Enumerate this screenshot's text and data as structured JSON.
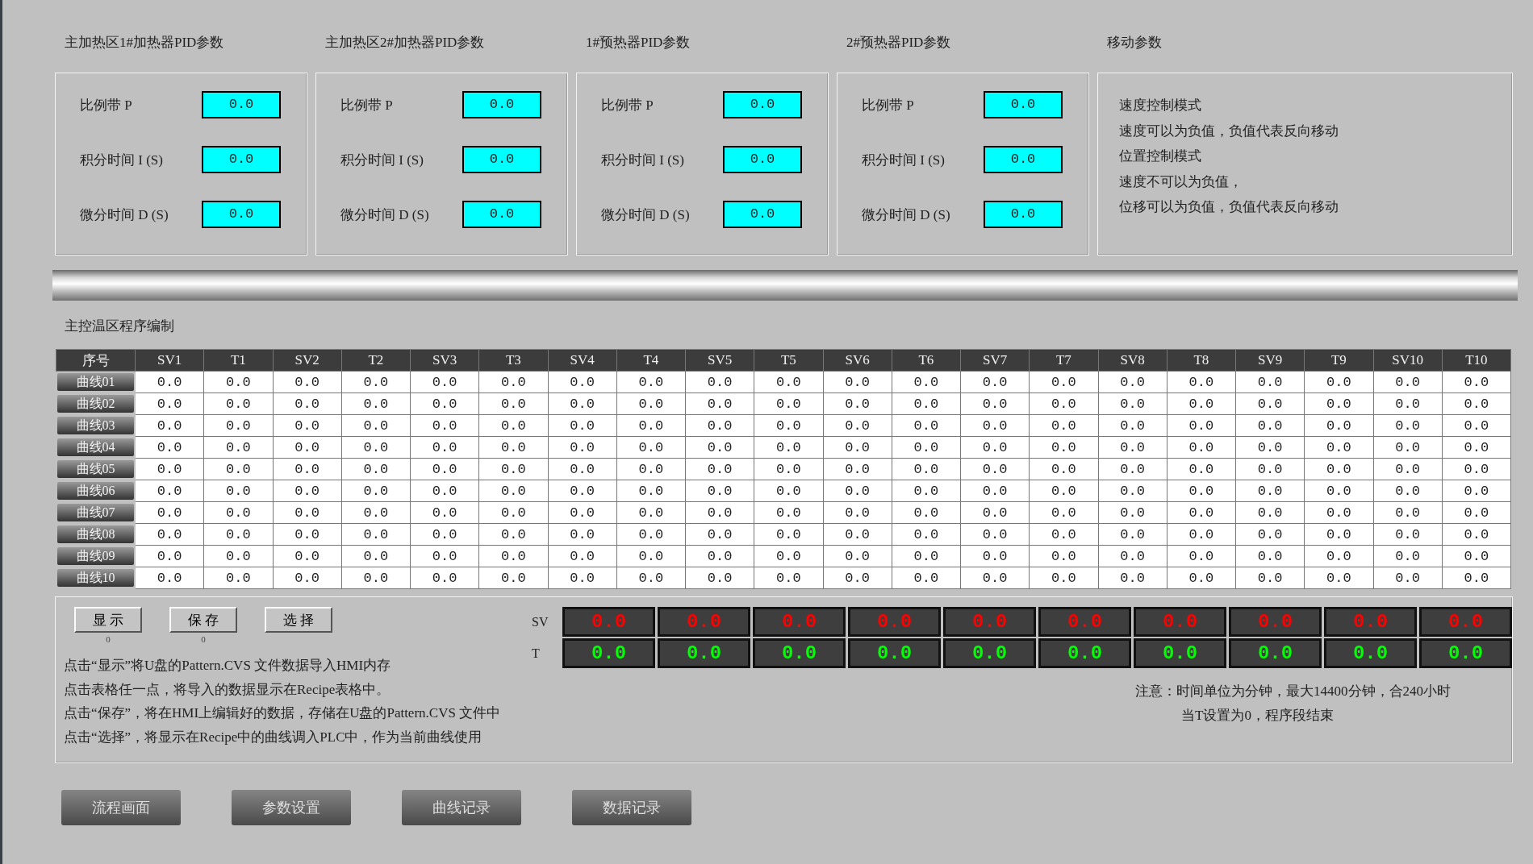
{
  "pid_panels": [
    {
      "title": "主加热区1#加热器PID参数",
      "params": [
        {
          "label": "比例带 P",
          "value": "0.0"
        },
        {
          "label": "积分时间 I (S)",
          "value": "0.0"
        },
        {
          "label": "微分时间 D (S)",
          "value": "0.0"
        }
      ]
    },
    {
      "title": "主加热区2#加热器PID参数",
      "params": [
        {
          "label": "比例带 P",
          "value": "0.0"
        },
        {
          "label": "积分时间 I (S)",
          "value": "0.0"
        },
        {
          "label": "微分时间 D (S)",
          "value": "0.0"
        }
      ]
    },
    {
      "title": "1#预热器PID参数",
      "params": [
        {
          "label": "比例带 P",
          "value": "0.0"
        },
        {
          "label": "积分时间 I (S)",
          "value": "0.0"
        },
        {
          "label": "微分时间 D (S)",
          "value": "0.0"
        }
      ]
    },
    {
      "title": "2#预热器PID参数",
      "params": [
        {
          "label": "比例带 P",
          "value": "0.0"
        },
        {
          "label": "积分时间 I (S)",
          "value": "0.0"
        },
        {
          "label": "微分时间 D (S)",
          "value": "0.0"
        }
      ]
    }
  ],
  "motion_panel": {
    "title": "移动参数",
    "lines": [
      "速度控制模式",
      "速度可以为负值，负值代表反向移动",
      "位置控制模式",
      "速度不可以为负值，",
      "位移可以为负值，负值代表反向移动"
    ]
  },
  "program_section": {
    "title": "主控温区程序编制",
    "table": {
      "columns": [
        "序号",
        "SV1",
        "T1",
        "SV2",
        "T2",
        "SV3",
        "T3",
        "SV4",
        "T4",
        "SV5",
        "T5",
        "SV6",
        "T6",
        "SV7",
        "T7",
        "SV8",
        "T8",
        "SV9",
        "T9",
        "SV10",
        "T10"
      ],
      "rows": [
        {
          "cells": [
            "曲线01",
            "0.0",
            "0.0",
            "0.0",
            "0.0",
            "0.0",
            "0.0",
            "0.0",
            "0.0",
            "0.0",
            "0.0",
            "0.0",
            "0.0",
            "0.0",
            "0.0",
            "0.0",
            "0.0",
            "0.0",
            "0.0",
            "0.0",
            "0.0"
          ]
        },
        {
          "cells": [
            "曲线02",
            "0.0",
            "0.0",
            "0.0",
            "0.0",
            "0.0",
            "0.0",
            "0.0",
            "0.0",
            "0.0",
            "0.0",
            "0.0",
            "0.0",
            "0.0",
            "0.0",
            "0.0",
            "0.0",
            "0.0",
            "0.0",
            "0.0",
            "0.0"
          ]
        },
        {
          "cells": [
            "曲线03",
            "0.0",
            "0.0",
            "0.0",
            "0.0",
            "0.0",
            "0.0",
            "0.0",
            "0.0",
            "0.0",
            "0.0",
            "0.0",
            "0.0",
            "0.0",
            "0.0",
            "0.0",
            "0.0",
            "0.0",
            "0.0",
            "0.0",
            "0.0"
          ]
        },
        {
          "cells": [
            "曲线04",
            "0.0",
            "0.0",
            "0.0",
            "0.0",
            "0.0",
            "0.0",
            "0.0",
            "0.0",
            "0.0",
            "0.0",
            "0.0",
            "0.0",
            "0.0",
            "0.0",
            "0.0",
            "0.0",
            "0.0",
            "0.0",
            "0.0",
            "0.0"
          ]
        },
        {
          "cells": [
            "曲线05",
            "0.0",
            "0.0",
            "0.0",
            "0.0",
            "0.0",
            "0.0",
            "0.0",
            "0.0",
            "0.0",
            "0.0",
            "0.0",
            "0.0",
            "0.0",
            "0.0",
            "0.0",
            "0.0",
            "0.0",
            "0.0",
            "0.0",
            "0.0"
          ]
        },
        {
          "cells": [
            "曲线06",
            "0.0",
            "0.0",
            "0.0",
            "0.0",
            "0.0",
            "0.0",
            "0.0",
            "0.0",
            "0.0",
            "0.0",
            "0.0",
            "0.0",
            "0.0",
            "0.0",
            "0.0",
            "0.0",
            "0.0",
            "0.0",
            "0.0",
            "0.0"
          ]
        },
        {
          "cells": [
            "曲线07",
            "0.0",
            "0.0",
            "0.0",
            "0.0",
            "0.0",
            "0.0",
            "0.0",
            "0.0",
            "0.0",
            "0.0",
            "0.0",
            "0.0",
            "0.0",
            "0.0",
            "0.0",
            "0.0",
            "0.0",
            "0.0",
            "0.0",
            "0.0"
          ]
        },
        {
          "cells": [
            "曲线08",
            "0.0",
            "0.0",
            "0.0",
            "0.0",
            "0.0",
            "0.0",
            "0.0",
            "0.0",
            "0.0",
            "0.0",
            "0.0",
            "0.0",
            "0.0",
            "0.0",
            "0.0",
            "0.0",
            "0.0",
            "0.0",
            "0.0",
            "0.0"
          ]
        },
        {
          "cells": [
            "曲线09",
            "0.0",
            "0.0",
            "0.0",
            "0.0",
            "0.0",
            "0.0",
            "0.0",
            "0.0",
            "0.0",
            "0.0",
            "0.0",
            "0.0",
            "0.0",
            "0.0",
            "0.0",
            "0.0",
            "0.0",
            "0.0",
            "0.0",
            "0.0"
          ]
        },
        {
          "cells": [
            "曲线10",
            "0.0",
            "0.0",
            "0.0",
            "0.0",
            "0.0",
            "0.0",
            "0.0",
            "0.0",
            "0.0",
            "0.0",
            "0.0",
            "0.0",
            "0.0",
            "0.0",
            "0.0",
            "0.0",
            "0.0",
            "0.0",
            "0.0",
            "0.0"
          ]
        }
      ]
    }
  },
  "controls": {
    "buttons": [
      {
        "label": "显 示",
        "counter": "0"
      },
      {
        "label": "保 存",
        "counter": "0"
      },
      {
        "label": "选 择"
      }
    ],
    "instructions": [
      "点击“显示”将U盘的Pattern.CVS 文件数据导入HMI内存",
      "点击表格任一点，将导入的数据显示在Recipe表格中。",
      "点击“保存”，将在HMI上编辑好的数据，存储在U盘的Pattern.CVS 文件中",
      "点击“选择”，将显示在Recipe中的曲线调入PLC中，作为当前曲线使用"
    ],
    "current_curve": {
      "sv_label": "SV",
      "t_label": "T",
      "sv_values": [
        "0.0",
        "0.0",
        "0.0",
        "0.0",
        "0.0",
        "0.0",
        "0.0",
        "0.0",
        "0.0",
        "0.0"
      ],
      "t_values": [
        "0.0",
        "0.0",
        "0.0",
        "0.0",
        "0.0",
        "0.0",
        "0.0",
        "0.0",
        "0.0",
        "0.0"
      ]
    },
    "notes": [
      "注意：时间单位为分钟，最大14400分钟，合240小时",
      "当T设置为0，程序段结束"
    ]
  },
  "nav_buttons": [
    "流程画面",
    "参数设置",
    "曲线记录",
    "数据记录"
  ]
}
